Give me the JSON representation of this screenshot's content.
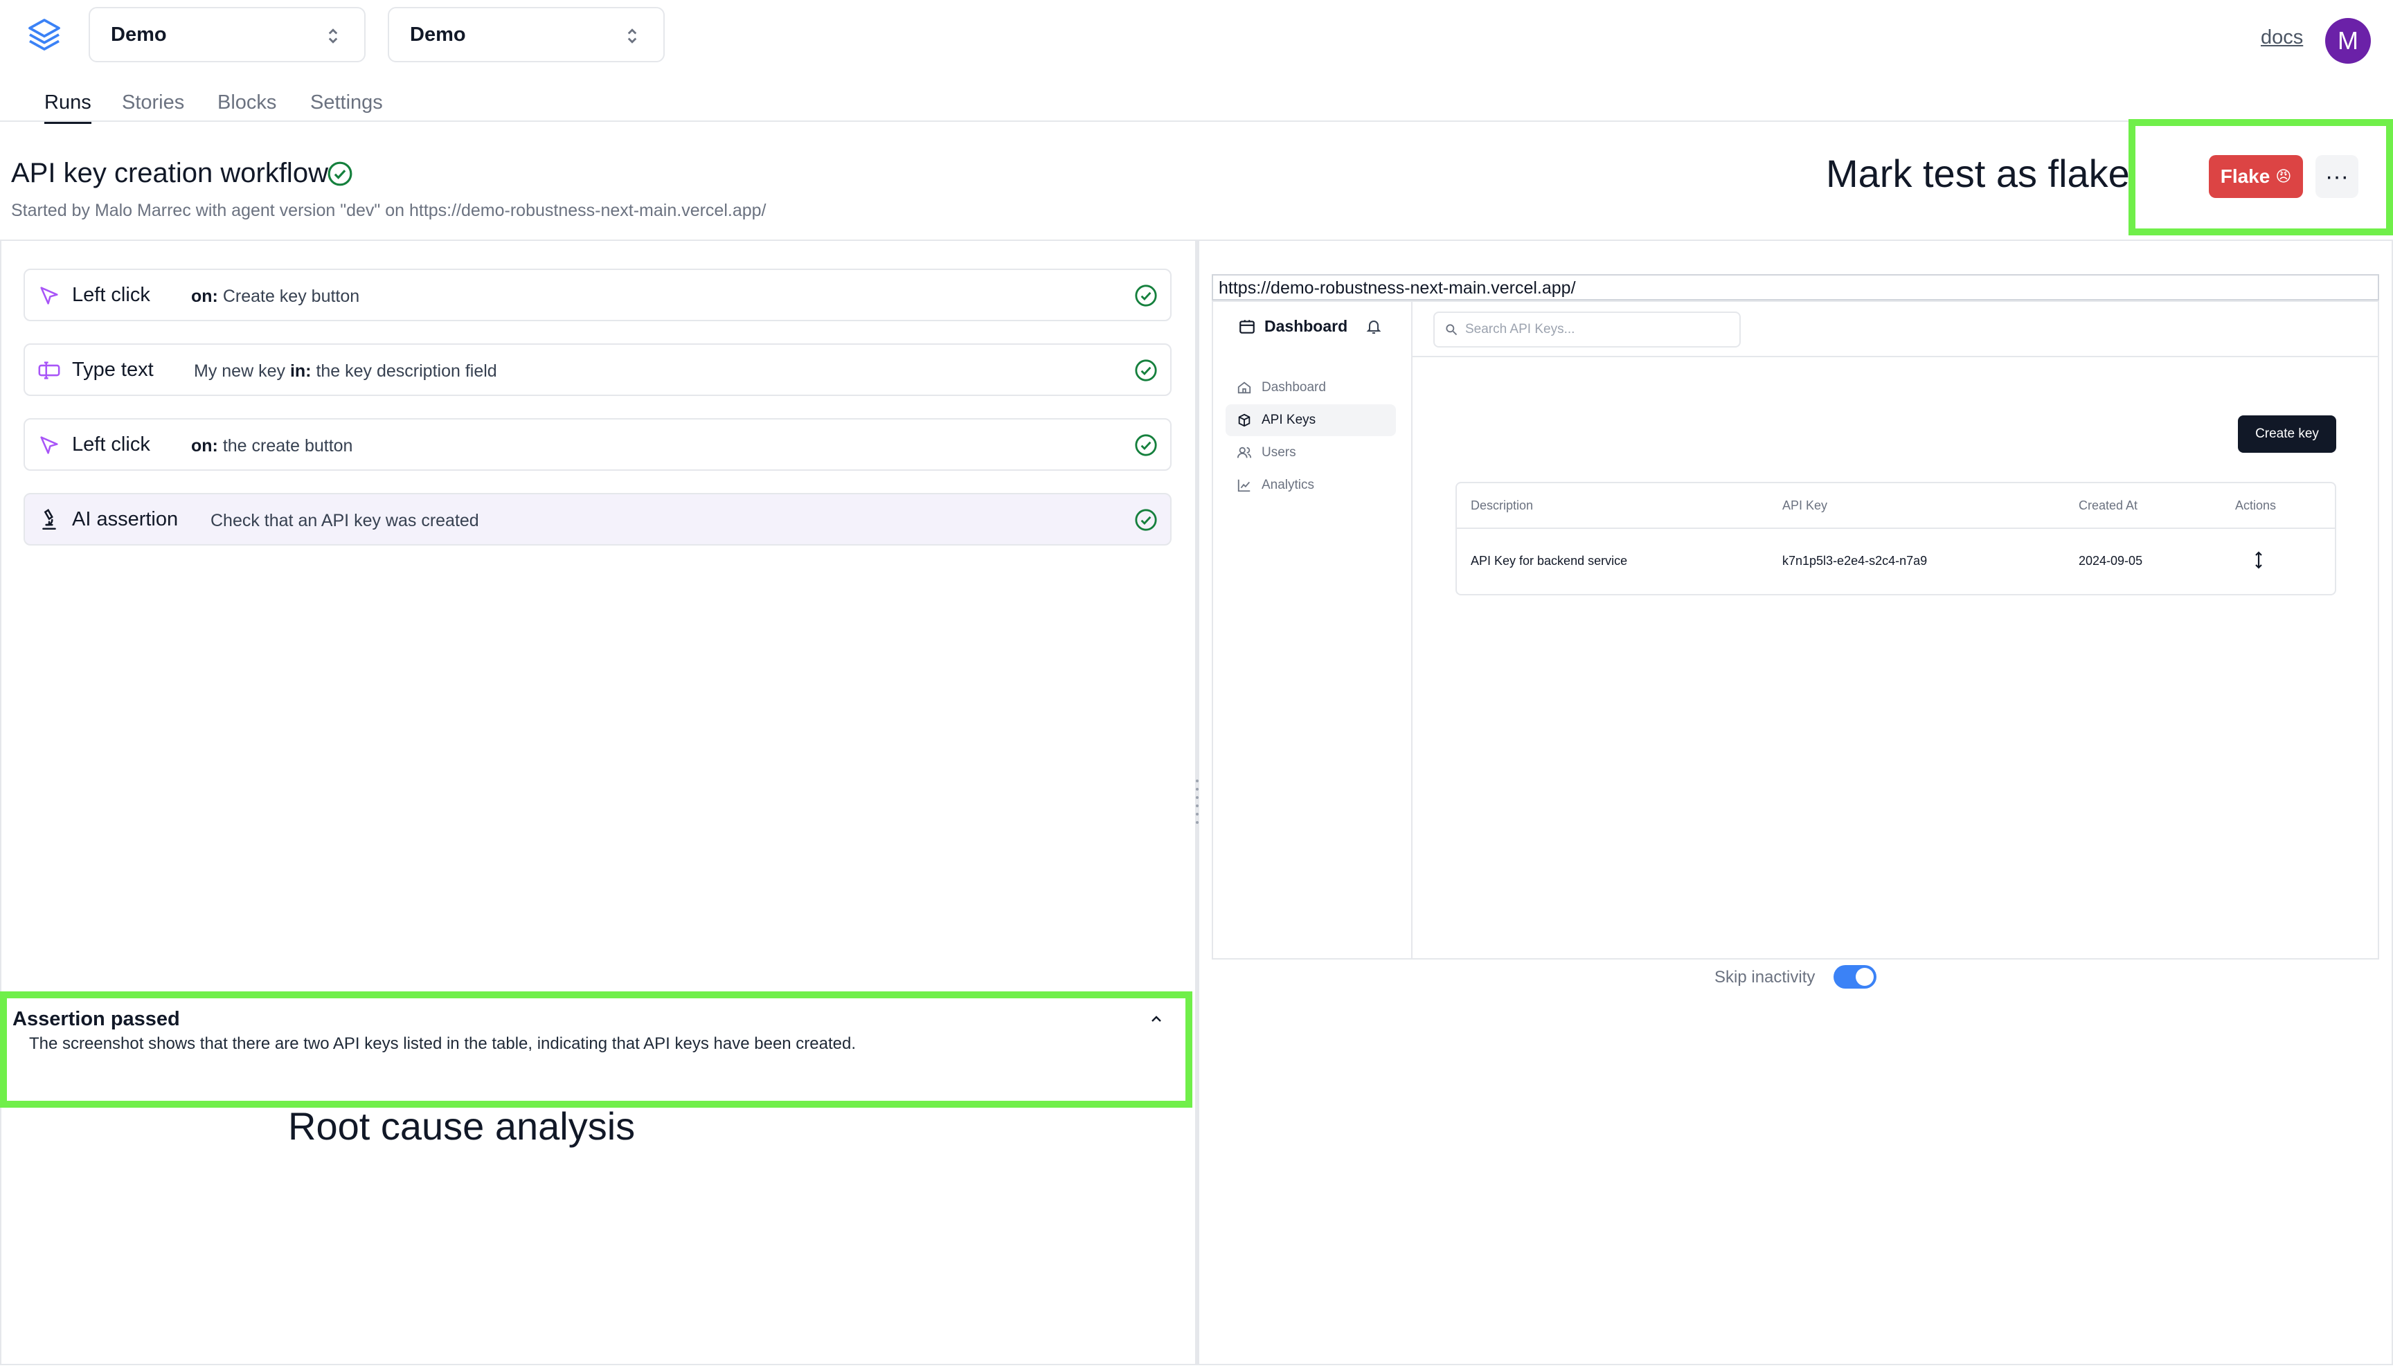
{
  "header": {
    "project_select": "Demo",
    "env_select": "Demo",
    "docs_label": "docs",
    "avatar_initial": "M"
  },
  "tabs": [
    {
      "label": "Runs",
      "active": true
    },
    {
      "label": "Stories",
      "active": false
    },
    {
      "label": "Blocks",
      "active": false
    },
    {
      "label": "Settings",
      "active": false
    }
  ],
  "run": {
    "title": "API key creation workflow",
    "subtitle": "Started by Malo Marrec with agent version \"dev\" on https://demo-robustness-next-main.vercel.app/",
    "status": "passed",
    "flake_label": "Flake",
    "flake_emoji": "😠",
    "more_label": "···"
  },
  "annotations": {
    "flake_note": "Mark test as flake",
    "root_cause_note": "Root cause analysis",
    "highlight_color": "#70ef4a"
  },
  "steps": [
    {
      "action": "Left click",
      "value": "",
      "prep": "on:",
      "target": "Create key button",
      "icon": "cursor-click-icon",
      "status": "passed"
    },
    {
      "action": "Type text",
      "value": "My new key",
      "prep": "in:",
      "target": "the key description field",
      "icon": "text-cursor-icon",
      "status": "passed"
    },
    {
      "action": "Left click",
      "value": "",
      "prep": "on:",
      "target": "the create button",
      "icon": "cursor-click-icon",
      "status": "passed"
    },
    {
      "action": "AI assertion",
      "value": "Check that an API key was created",
      "prep": "",
      "target": "",
      "icon": "microscope-icon",
      "status": "passed"
    }
  ],
  "assertion": {
    "title": "Assertion passed",
    "text": "The screenshot shows that there are two API keys listed in the table, indicating that API keys have been created."
  },
  "replay": {
    "url": "https://demo-robustness-next-main.vercel.app/",
    "brand": "Dashboard",
    "search_placeholder": "Search API Keys...",
    "nav": [
      {
        "label": "Dashboard",
        "icon": "home-icon",
        "active": false
      },
      {
        "label": "API Keys",
        "icon": "package-icon",
        "active": true
      },
      {
        "label": "Users",
        "icon": "users-icon",
        "active": false
      },
      {
        "label": "Analytics",
        "icon": "line-chart-icon",
        "active": false
      }
    ],
    "create_key_label": "Create key",
    "table": {
      "headers": [
        "Description",
        "API Key",
        "Created At",
        "Actions"
      ],
      "rows": [
        [
          "API Key for backend service",
          "k7n1p5l3-e2e4-s2c4-n7a9",
          "2024-09-05"
        ]
      ]
    },
    "skip_inactivity_label": "Skip inactivity",
    "skip_inactivity_on": true
  },
  "colors": {
    "flake_button": "#dc4444",
    "accent_purple": "#a855f7",
    "success_green": "#15803d",
    "avatar": "#6b21a8",
    "toggle": "#3b82f6"
  }
}
